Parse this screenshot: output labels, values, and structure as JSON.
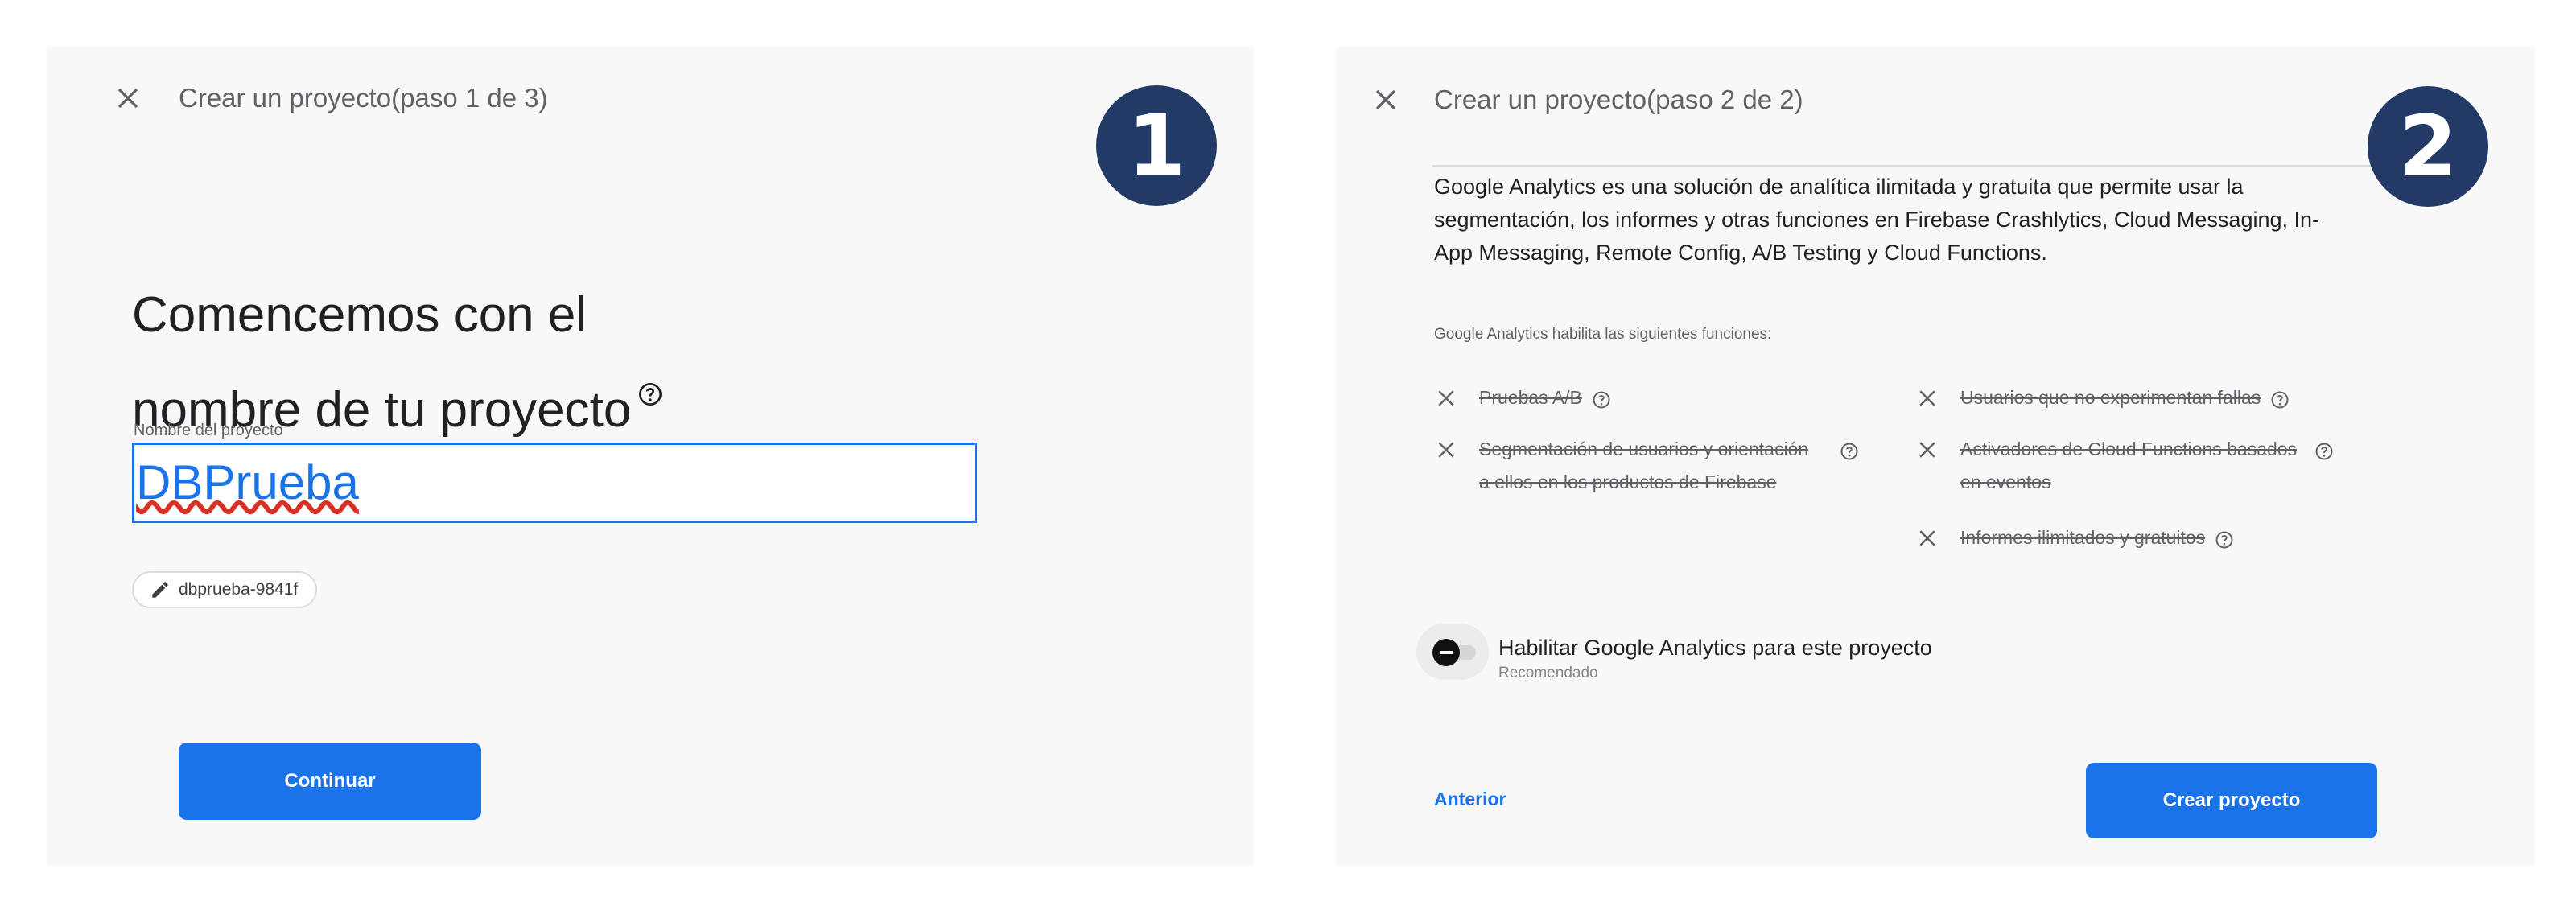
{
  "step1": {
    "title": "Crear un proyecto(paso 1 de 3)",
    "badge": "1",
    "heading_line1": "Comencemos con el",
    "heading_line2": "nombre de tu proyecto",
    "field_label": "Nombre del proyecto",
    "project_name": "DBPrueba",
    "project_id": "dbprueba-9841f",
    "continue_label": "Continuar"
  },
  "step2": {
    "title": "Crear un proyecto(paso 2 de 2)",
    "badge": "2",
    "description": "Google Analytics es una solución de analítica ilimitada y gratuita que permite usar la segmentación, los informes y otras funciones en Firebase Crashlytics, Cloud Messaging, In-App Messaging, Remote Config, A/B Testing y Cloud Functions.",
    "features_label": "Google Analytics habilita las siguientes funciones:",
    "features": [
      "Pruebas A/B",
      "Segmentación de usuarios y orientación a ellos en los productos de Firebase",
      "Usuarios que no experimentan fallas",
      "Activadores de Cloud Functions basados en eventos",
      "Informes ilimitados y gratuitos"
    ],
    "toggle_label": "Habilitar Google Analytics para este proyecto",
    "toggle_sub": "Recomendado",
    "toggle_enabled": false,
    "back_label": "Anterior",
    "create_label": "Crear proyecto"
  },
  "colors": {
    "accent": "#1a73e8",
    "badge": "#233a66",
    "panel_bg": "#f8f8f8"
  },
  "icons": [
    "close-icon",
    "help-icon",
    "edit-pencil-icon",
    "disabled-x-icon"
  ]
}
